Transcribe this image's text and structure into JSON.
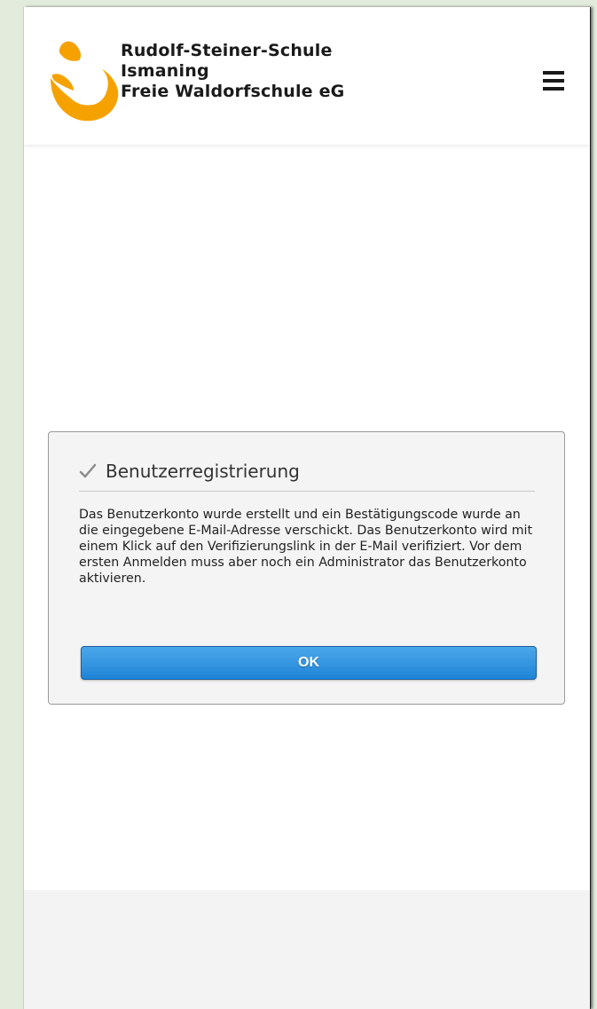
{
  "header": {
    "school_name_line1": "Rudolf-Steiner-Schule",
    "school_name_line2": "Ismaning",
    "school_name_line3": "Freie Waldorfschule eG",
    "logo_icon": "school-logo-icon",
    "menu_icon": "hamburger-menu-icon"
  },
  "dialog": {
    "icon": "checkmark-icon",
    "title": "Benutzerregistrierung",
    "message": "Das Benutzerkonto wurde erstellt und ein Bestätigungscode wurde an die eingegebene E-Mail-Adresse verschickt. Das Benutzerkonto wird mit einem Klick auf den Verifizierungslink in der E-Mail verifiziert. Vor dem ersten Anmelden muss aber noch ein Administrator das Benutzerkonto aktivieren.",
    "ok_label": "OK"
  },
  "colors": {
    "accent_orange": "#f5a200",
    "button_blue": "#2b8fde",
    "page_background": "#e2ebdc"
  }
}
